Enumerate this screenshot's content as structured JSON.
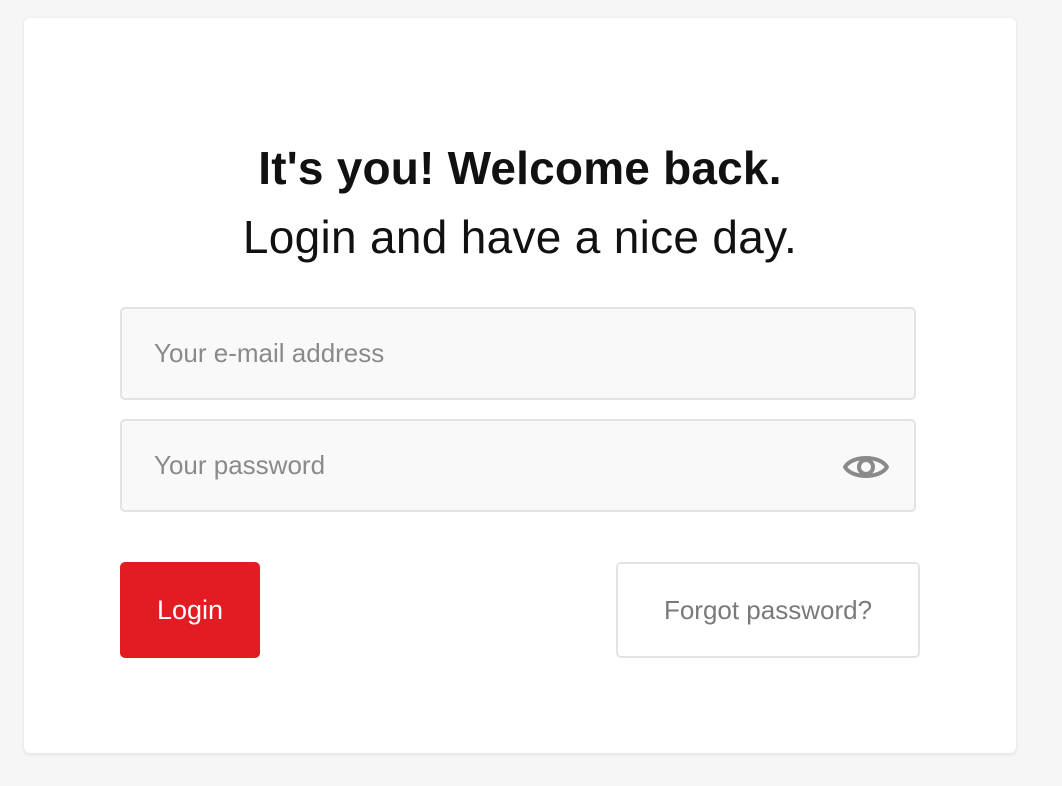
{
  "heading": {
    "title": "It's you! Welcome back.",
    "subtitle": "Login and have a nice day."
  },
  "email": {
    "placeholder": "Your e-mail address",
    "value": ""
  },
  "password": {
    "placeholder": "Your password",
    "value": "",
    "toggle_icon": "eye-icon"
  },
  "actions": {
    "login_label": "Login",
    "forgot_label": "Forgot password?"
  },
  "colors": {
    "accent": "#e31b23",
    "page_background": "#f6f6f6",
    "card_background": "#ffffff",
    "field_background": "#f9f9f9",
    "field_border": "#e3e3e3",
    "placeholder_text": "#8a8a8a",
    "icon": "#8a8a8a"
  }
}
